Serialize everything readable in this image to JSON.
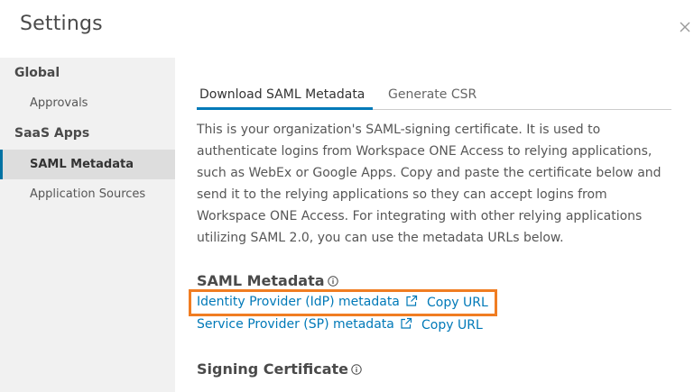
{
  "dialog": {
    "title": "Settings"
  },
  "sidebar": {
    "groups": [
      {
        "label": "Global",
        "items": [
          {
            "label": "Approvals"
          }
        ]
      },
      {
        "label": "SaaS Apps",
        "items": [
          {
            "label": "SAML Metadata",
            "active": true
          },
          {
            "label": "Application Sources"
          }
        ]
      }
    ]
  },
  "tabs": [
    {
      "label": "Download SAML Metadata",
      "active": true
    },
    {
      "label": "Generate CSR",
      "active": false
    }
  ],
  "content": {
    "description": "This is your organization's SAML-signing certificate. It is used to authenticate logins from Workspace ONE Access to relying applications, such as WebEx or Google Apps. Copy and paste the certificate below and send it to the relying applications so they can accept logins from Workspace ONE Access. For integrating with other relying applications utilizing SAML 2.0, you can use the metadata URLs below.",
    "saml_metadata_title": "SAML Metadata",
    "idp_metadata_label": "Identity Provider (IdP) metadata",
    "sp_metadata_label": "Service Provider (SP) metadata",
    "copy_url_label": "Copy URL",
    "signing_certificate_title": "Signing Certificate"
  },
  "colors": {
    "accent": "#0079b8",
    "highlight": "#f07d22",
    "sidebar_bg": "#f1f1f1",
    "active_item_bg": "#dddddd"
  },
  "icons": {
    "close": "close-icon",
    "info": "info-icon",
    "external_link": "external-link-icon"
  }
}
